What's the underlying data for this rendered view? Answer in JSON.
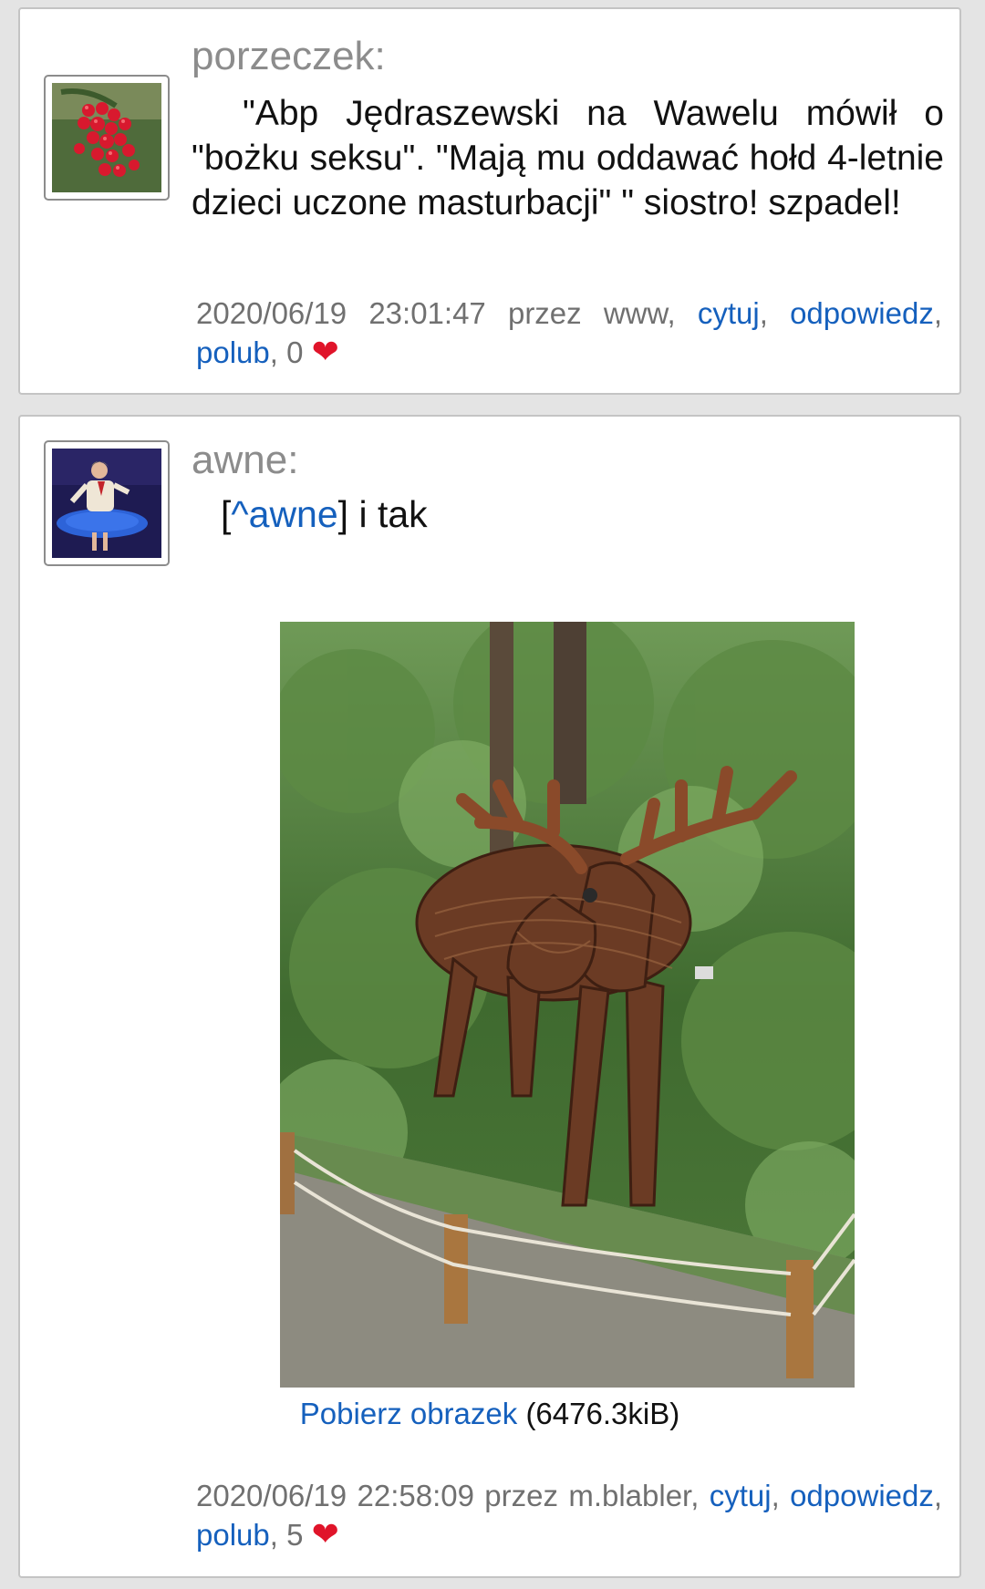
{
  "posts": [
    {
      "author": "porzeczek:",
      "content": "\"Abp Jędraszewski na Wawelu mówił o \"bożku seksu\". \"Mają mu oddawać hołd 4-letnie dzieci uczone masturbacji\" \" siostro! szpadel!",
      "meta": {
        "datetime": "2020/06/19 23:01:47",
        "by_label": "przez",
        "user": "www,",
        "quote_label": "cytuj",
        "reply_label": "odpowiedz",
        "like_label": "polub",
        "likes": "0",
        "heart": "❤"
      },
      "avatar_icon": "red-currant-avatar"
    },
    {
      "author": "awne:",
      "reply_ref_open": "[",
      "reply_ref": "^awne",
      "reply_ref_close": "]",
      "reply_text": " i tak",
      "download_label": "Pobierz obrazek",
      "download_size": "(6476.3kiB)",
      "meta": {
        "datetime_date": "2020/06/19",
        "datetime_time": "22:58:09",
        "by_label": "przez",
        "user": "m.blabler,",
        "quote_label": "cytuj",
        "reply_label": "odpowiedz",
        "like_label": "polub",
        "likes": "5",
        "heart": "❤"
      },
      "avatar_icon": "dancer-avatar",
      "image_icon": "wicker-moose-photo"
    }
  ],
  "colors": {
    "link": "#1560bd",
    "author": "#8c8c8c",
    "heart": "#e0142a",
    "page_bg": "#e4e4e4"
  }
}
